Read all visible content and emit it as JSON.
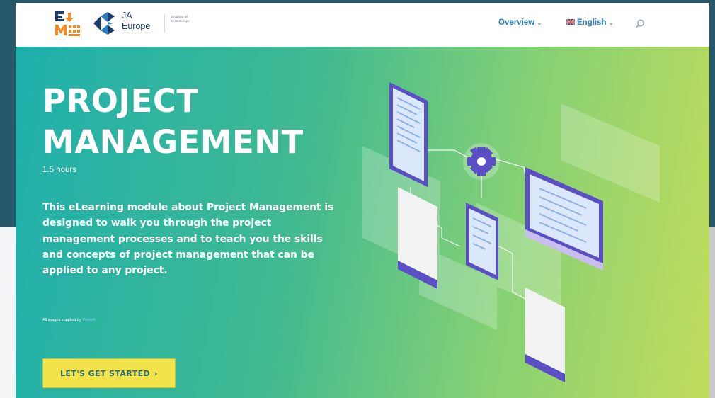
{
  "header": {
    "logo_em": "E M",
    "logo_ja_name": "JA\nEurope",
    "tagline": "Enabling all\nto be Europe",
    "nav": {
      "overview": "Overview",
      "language": "English"
    },
    "icons": {
      "search": "search-icon",
      "chevron": "chevron-down-icon",
      "flag": "uk-flag-icon"
    }
  },
  "hero": {
    "title": "PROJECT\nMANAGEMENT",
    "duration": "1.5 hours",
    "description": "This eLearning module about Project Management is designed to walk you through the project management processes and to teach you the skills and concepts of project management that can be applied to any project.",
    "credit_prefix": "All images supplied by",
    "credit_source": "Freepik",
    "cta_label": "LET'S GET STARTED",
    "cta_icon": "chevron-right-icon"
  },
  "colors": {
    "nav_link": "#2a7fc3",
    "hero_gradient_start": "#1fb0ad",
    "hero_gradient_end": "#c2dc5c",
    "cta_bg": "#f2e34a",
    "cta_text": "#2a6a76",
    "logo_orange": "#f18a21",
    "logo_navy": "#1c3b6b",
    "illustration_purple": "#5b4fc5"
  }
}
